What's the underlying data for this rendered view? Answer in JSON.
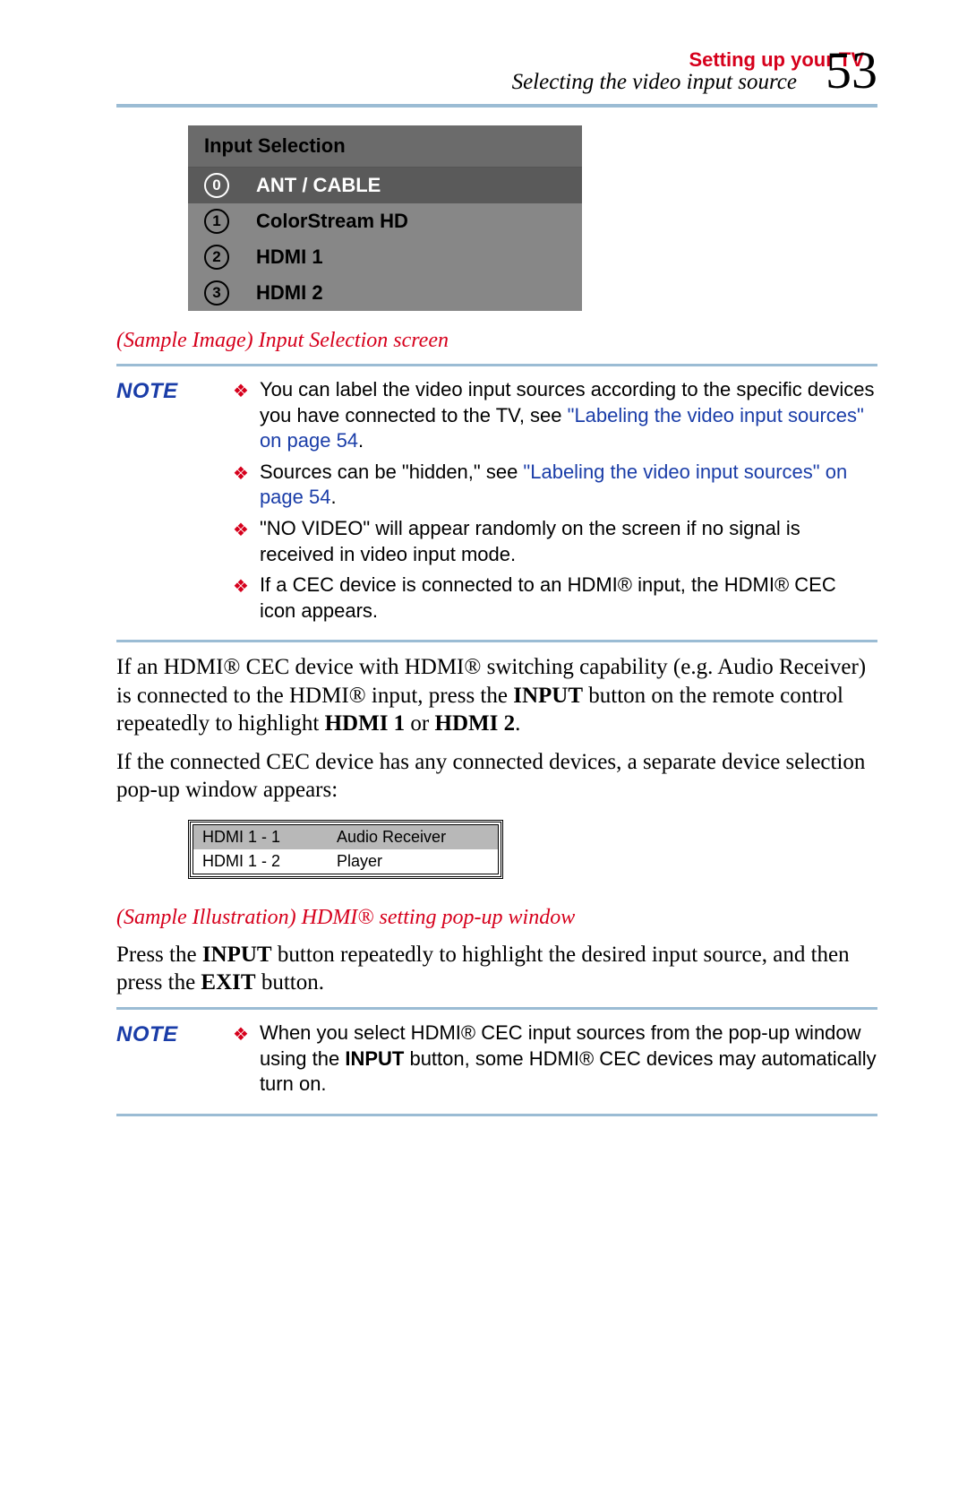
{
  "header": {
    "chapter": "Setting up your TV",
    "section": "Selecting the video input source",
    "page_number": "53"
  },
  "input_selection": {
    "title": "Input Selection",
    "items": [
      {
        "num": "0",
        "label": "ANT / CABLE",
        "selected": true
      },
      {
        "num": "1",
        "label": "ColorStream HD",
        "selected": false
      },
      {
        "num": "2",
        "label": "HDMI 1",
        "selected": false
      },
      {
        "num": "3",
        "label": "HDMI 2",
        "selected": false
      }
    ]
  },
  "caption1": "(Sample Image) Input Selection screen",
  "note1": {
    "label": "NOTE",
    "bullets": {
      "b1_pre": "You can label the video input sources according to the specific devices you have connected to the TV, see ",
      "b1_link": "\"Labeling the video input sources\" on page 54",
      "b1_post": ".",
      "b2_pre": "Sources can be \"hidden,\" see ",
      "b2_link": "\"Labeling the video input sources\" on page 54",
      "b2_post": ".",
      "b3": "\"NO VIDEO\" will appear randomly on the screen if no signal is received in video input mode.",
      "b4": "If a CEC device is connected to an HDMI® input, the HDMI® CEC icon appears."
    }
  },
  "body1": {
    "p1a": "If an HDMI® CEC device with HDMI® switching capability (e.g. Audio Receiver) is connected to the HDMI® input, press the ",
    "p1b_bold": "INPUT",
    "p1c": " button on the remote control repeatedly to highlight ",
    "p1d_bold": "HDMI 1",
    "p1e": " or ",
    "p1f_bold": "HDMI 2",
    "p1g": ".",
    "p2": "If the connected CEC device has any connected devices, a separate device selection pop-up window appears:"
  },
  "popup": {
    "rows": [
      {
        "left": "HDMI 1 -  1",
        "right": "Audio Receiver",
        "selected": true
      },
      {
        "left": "HDMI 1 -  2",
        "right": "Player",
        "selected": false
      }
    ]
  },
  "caption2": "(Sample Illustration) HDMI® setting pop-up window",
  "body2": {
    "pre": "Press the ",
    "b1": "INPUT",
    "mid": " button repeatedly to highlight the desired input source, and then press the ",
    "b2": "EXIT",
    "post": " button."
  },
  "note2": {
    "label": "NOTE",
    "pre": "When you select HDMI® CEC input sources from the pop-up window using the ",
    "bold": "INPUT",
    "post": " button, some HDMI® CEC devices may automatically turn on."
  }
}
